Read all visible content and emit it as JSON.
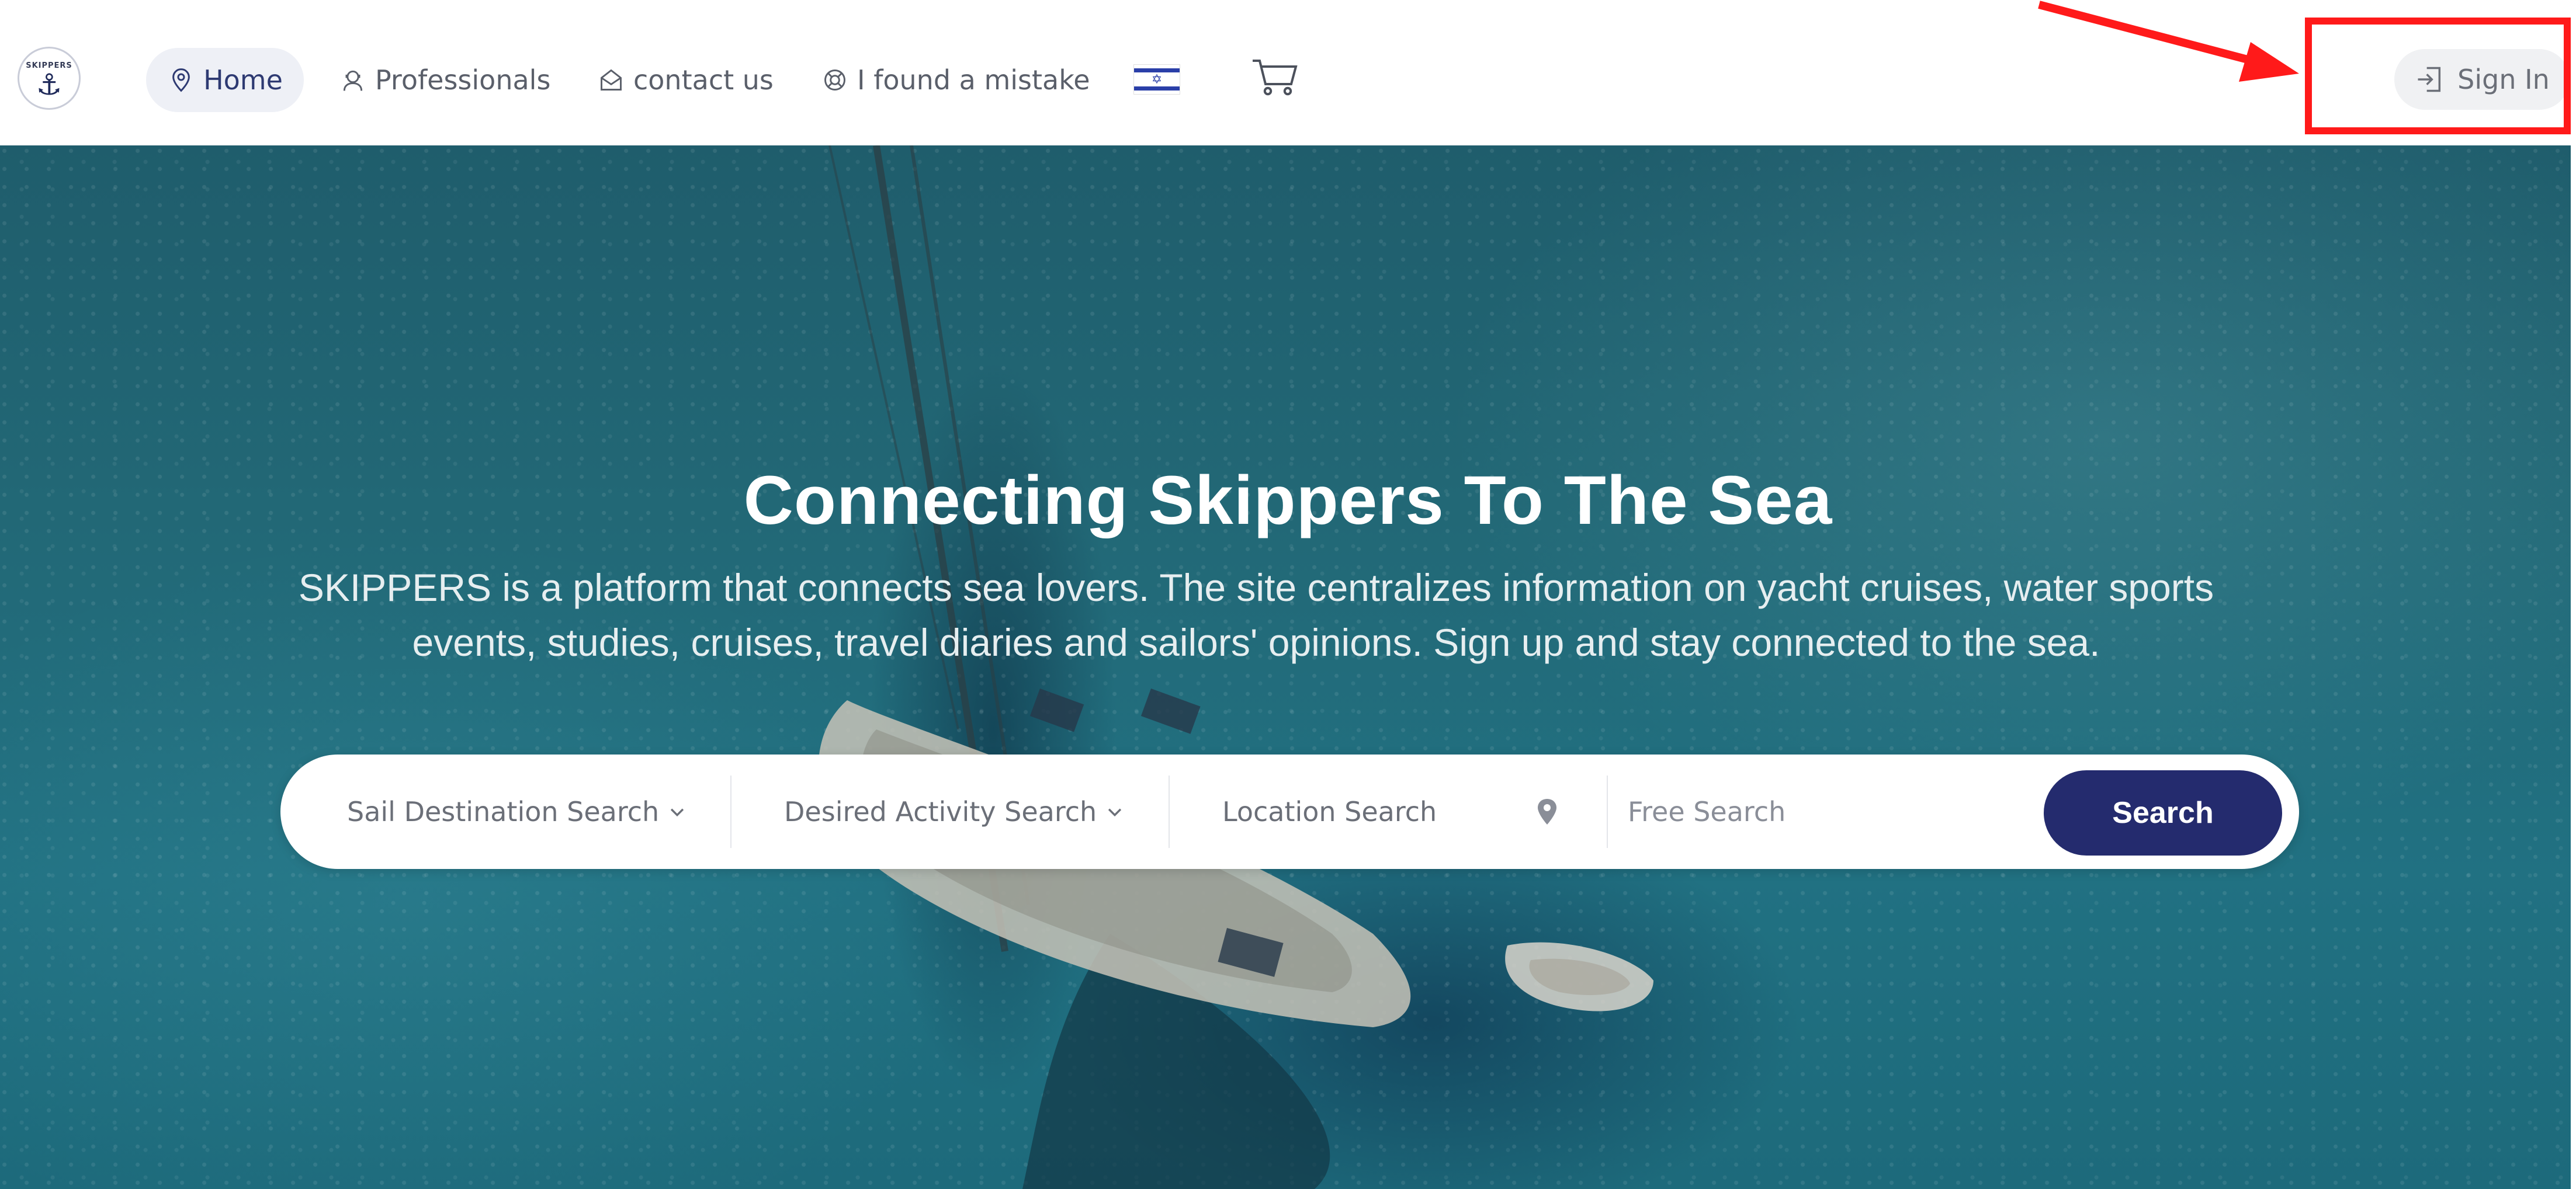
{
  "nav": {
    "logo_text": "SKIPPERS",
    "items": [
      {
        "label": "Home",
        "icon": "location-pin-icon"
      },
      {
        "label": "Professionals",
        "icon": "user-headset-icon"
      },
      {
        "label": "contact us",
        "icon": "envelope-open-icon"
      },
      {
        "label": "I found a mistake",
        "icon": "lifebuoy-icon"
      }
    ],
    "language_flag": "israel-flag-icon",
    "cart_icon": "shopping-cart-icon",
    "signin_label": "Sign In",
    "signin_icon": "login-icon"
  },
  "annotation": {
    "highlight_color": "#ff1a1a",
    "arrow_target": "Sign In"
  },
  "hero": {
    "title": "Connecting Skippers To The Sea",
    "description": "SKIPPERS is a platform that connects sea lovers. The site centralizes information on yacht cruises, water sports events, studies, cruises, travel diaries and sailors' opinions. Sign up and stay connected to the sea."
  },
  "search": {
    "destination_label": "Sail Destination Search",
    "activity_label": "Desired Activity Search",
    "location_label": "Location Search",
    "free_placeholder": "Free Search",
    "button_label": "Search",
    "button_color": "#242b6e"
  },
  "colors": {
    "accent": "#242b6e",
    "nav_text": "#5a5f6a",
    "home_active_bg": "#eef0f6",
    "sea": "#226876"
  }
}
